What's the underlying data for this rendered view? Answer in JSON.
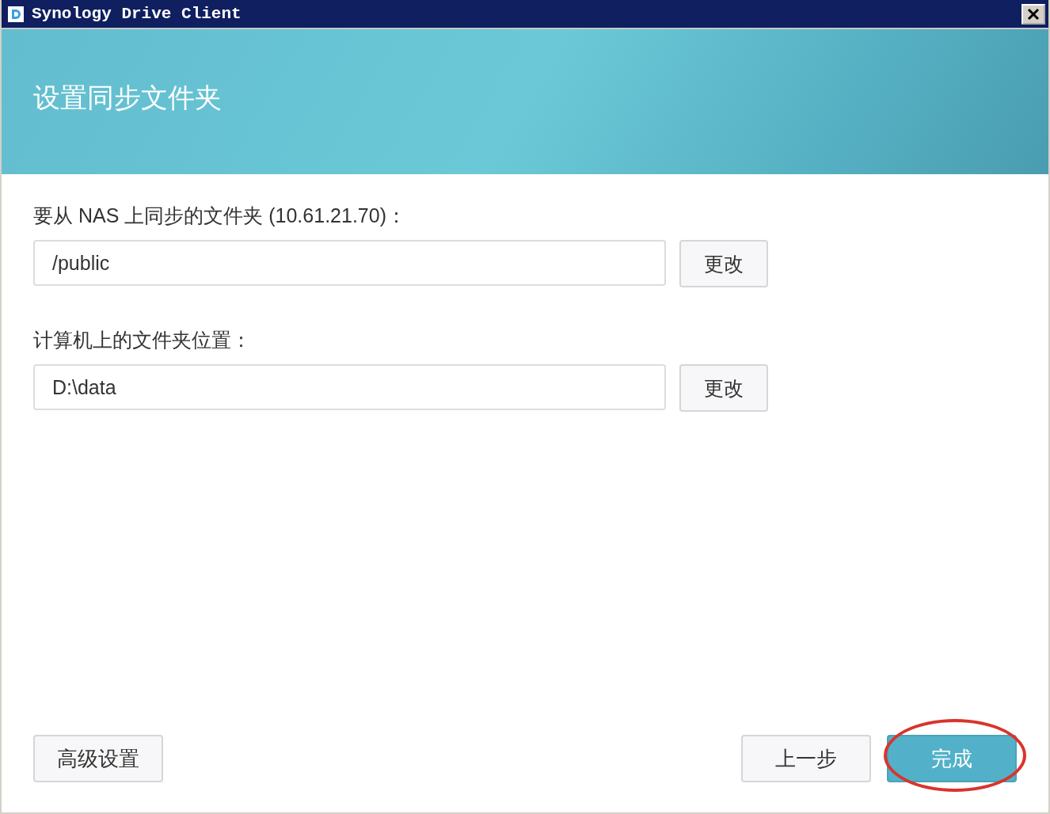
{
  "window": {
    "title": "Synology Drive Client"
  },
  "header": {
    "title": "设置同步文件夹"
  },
  "fields": [
    {
      "label": "要从 NAS 上同步的文件夹 (10.61.21.70)：",
      "value": "/public",
      "button": "更改"
    },
    {
      "label": "计算机上的文件夹位置：",
      "value": "D:\\data",
      "button": "更改"
    }
  ],
  "footer": {
    "left_button": "高级设置",
    "buttons": [
      {
        "label": "上一步",
        "kind": "secondary",
        "circled": false
      },
      {
        "label": "完成",
        "kind": "primary",
        "circled": true
      }
    ]
  }
}
